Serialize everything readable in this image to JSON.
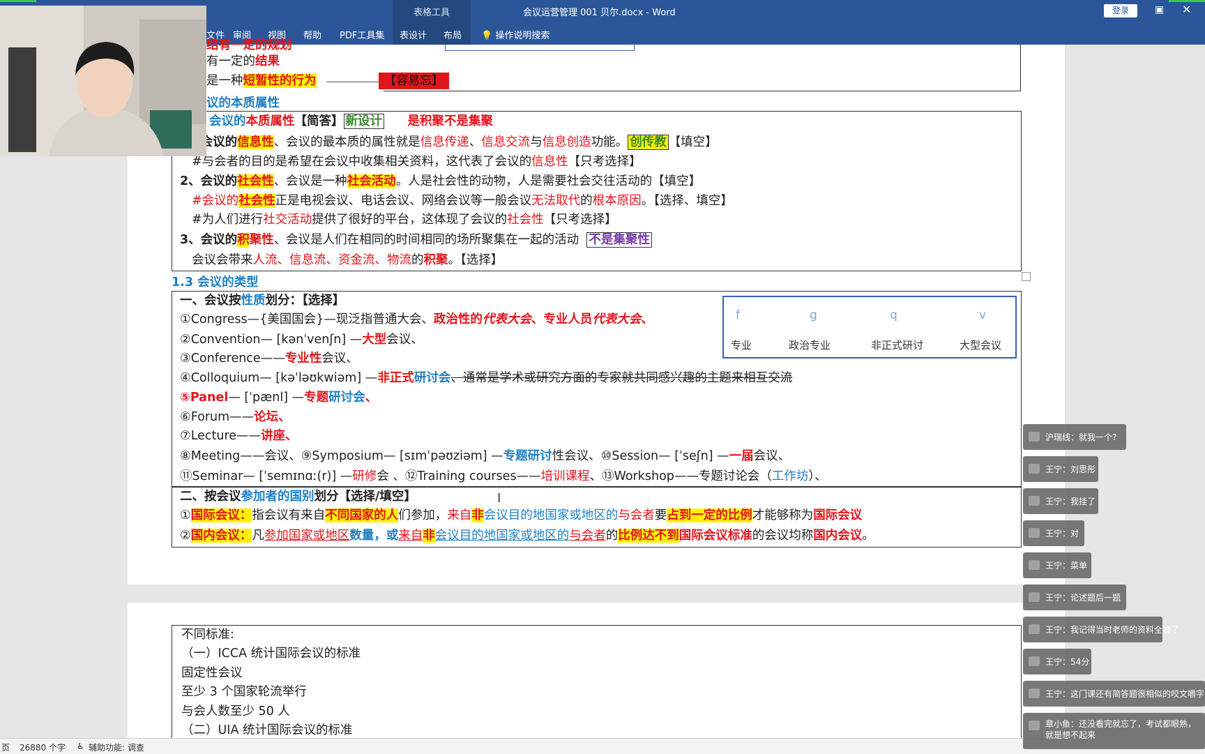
{
  "titlebar": {
    "context_group_label": "表格工具",
    "doc_title": "会议运营管理  001  贝尔.docx  -  Word",
    "login_label": "登录",
    "tabs": [
      "文件",
      "审阅",
      "视图",
      "帮助",
      "PDF工具集",
      "表设计",
      "布局"
    ],
    "search_label": "操作说明搜索"
  },
  "top_fragment": {
    "line1": "结有一定的规划",
    "line2_pre": "有一定的",
    "line2_red": "结果",
    "line3_pre": "是一种",
    "line3_hl": "短暂性的行为",
    "line3_tag": "【容易忘】"
  },
  "section_essence": {
    "heading": "议的本质属性",
    "title_pre": "会议的",
    "title_red": "本质属性",
    "title_post": "【简答】",
    "title_box": "新设计",
    "title_tail": "是积聚不是集聚",
    "item1_a": "1、会议的",
    "item1_b": "信息性",
    "item1_c": "、会议的最本质的属性就是",
    "item1_d": "信息传递",
    "item1_e": "、",
    "item1_f": "信息交流",
    "item1_g": "与",
    "item1_h": "信息创造",
    "item1_i": "功能。",
    "item1_box": "创传教",
    "item1_tail": "【填空】",
    "item1_note_pre": "#与会者的目的是希望在会议中收集相关资料，这代表了会议的",
    "item1_note_red": "信息性",
    "item1_note_tail": "【只考选择】",
    "item2_a": "2、会议的",
    "item2_b": "社会性",
    "item2_c": "、会议是一种",
    "item2_d": "社会活动",
    "item2_e": "。人是社会性的动物，人是需要社会交往活动的【填空】",
    "item2_note1_a": "#会议的",
    "item2_note1_b": "社会性",
    "item2_note1_c": "正是电视会议、电话会议、网络会议等一般会议",
    "item2_note1_d": "无法取代",
    "item2_note1_e": "的",
    "item2_note1_f": "根本原因",
    "item2_note1_g": "。【选择、填空】",
    "item2_note2_a": "#为人们进行",
    "item2_note2_b": "社交活动",
    "item2_note2_c": "提供了很好的平台，这体现了会议的",
    "item2_note2_d": "社会性",
    "item2_note2_e": "【只考选择】",
    "item3_a": "3、会议的",
    "item3_b": "积",
    "item3_c": "聚性",
    "item3_d": "、会议是人们在相同的时间相同的场所聚集在一起的活动",
    "item3_box": "不是集聚性",
    "item3_note_a": "会议会带来",
    "item3_note_b": "人流、信息流、资金流、物流",
    "item3_note_c": "的",
    "item3_note_d": "积聚",
    "item3_note_e": "。【选择】"
  },
  "section_types": {
    "heading": "1.3 会议的类型",
    "part1_title_a": "一、会议按",
    "part1_title_b": "性质",
    "part1_title_c": "划分：【选择】",
    "t1_a": "①Congress—{美国国会}—现泛指普通大会、",
    "t1_b": "政治性的",
    "t1_c": "代表大会",
    "t1_d": "、专业人员",
    "t1_e": "代表大会",
    "t1_f": "、",
    "t2_a": "②Convention— [kənˈvenʃn] —",
    "t2_b": "大型",
    "t2_c": "会议、",
    "t3_a": "③Conference——",
    "t3_b": "专业性",
    "t3_c": "会议、",
    "t4_a": "④Colloquium— [kəˈləʊkwiəm] —",
    "t4_b": "非正式",
    "t4_c": "研讨会",
    "t4_d": "、通常是学术或研究方面的专家就共同感兴趣的主题来相互交流",
    "t5_a": "⑤Panel",
    "t5_b": "— [ˈpænl] —",
    "t5_c": "专题",
    "t5_d": "研讨会",
    "t5_e": "、",
    "t6_a": "⑥Forum——",
    "t6_b": "论坛、",
    "t7_a": "⑦Lecture——",
    "t7_b": "讲座、",
    "t8_a": "⑧Meeting——会议、⑨Symposium— [sɪmˈpəʊziəm] —",
    "t8_b": "专题研讨",
    "t8_c": "性会议、⑩Session— [ˈseʃn] —",
    "t8_d": "一届",
    "t8_e": "会议、",
    "t9_a": "⑪Seminar— [ˈsemɪnɑː(r)] —",
    "t9_b": "研修",
    "t9_c": "会 、⑫Training courses——",
    "t9_d": "培训课程",
    "t9_e": "、⑬Workshop——专题讨论会（",
    "t9_f": "工作坊",
    "t9_g": "）、",
    "legend": [
      {
        "letter": "f",
        "word": "专业"
      },
      {
        "letter": "g",
        "word": "政治专业"
      },
      {
        "letter": "q",
        "word": "非正式研讨"
      },
      {
        "letter": "v",
        "word": "大型会议"
      }
    ],
    "part2_title_a": "二、按会议",
    "part2_title_b": "参加者的国别",
    "part2_title_c": "划分【选择/填空】",
    "p2_1_a": "①",
    "p2_1_b": "国际会议：",
    "p2_1_c": "指会议有来自",
    "p2_1_d": "不同国家的人",
    "p2_1_e": "们参加，",
    "p2_1_f": "来自",
    "p2_1_g": "非",
    "p2_1_h": "会议目的地国家或地区的",
    "p2_1_i": "与会者",
    "p2_1_j": "要",
    "p2_1_k": "占到一定的比例",
    "p2_1_l": "才能够称为",
    "p2_1_m": "国际会议",
    "p2_2_a": "②",
    "p2_2_b": "国内会议：",
    "p2_2_c": "凡",
    "p2_2_d": "参加国家或地区",
    "p2_2_e": "数量",
    "p2_2_f": "，或",
    "p2_2_g": "来自",
    "p2_2_h": "非",
    "p2_2_i": "会议目的地国家或地区的",
    "p2_2_j": "与会者",
    "p2_2_k": "的",
    "p2_2_l": "比例达不到",
    "p2_2_m": "国际会议标准",
    "p2_2_n": "的会议均称",
    "p2_2_o": "国内会议",
    "p2_2_p": "。"
  },
  "page2": {
    "lines": [
      "不同标准:",
      "（一）ICCA 统计国际会议的标准",
      "固定性会议",
      "至少 3 个国家轮流举行",
      "与会人数至少 50 人",
      "（二）UIA 统计国际会议的标准"
    ]
  },
  "statusbar": {
    "page": "页",
    "word_count": "26880 个字",
    "accessibility": "辅助功能: 调查"
  },
  "chat": [
    {
      "user": "沪瑞线",
      "text": "沪瑞线：就我一个?"
    },
    {
      "user": "王宁",
      "text": "王宁：刘思彤"
    },
    {
      "user": "王宁",
      "text": "王宁：我挂了"
    },
    {
      "user": "王宁",
      "text": "王宁：对"
    },
    {
      "user": "王宁",
      "text": "王宁：菜单"
    },
    {
      "user": "王宁",
      "text": "王宁：论述题后一题"
    },
    {
      "user": "王宁",
      "text": "王宁：我记得当时老师的资料全被了"
    },
    {
      "user": "王宁",
      "text": "王宁：54分"
    },
    {
      "user": "王宁",
      "text": "王宁：这门课还有简答题很相似的咬文嚼字"
    },
    {
      "user": "章小鱼",
      "text": "章小鱼：还没看完就忘了，考试都眼熟，就是想不起来"
    }
  ]
}
